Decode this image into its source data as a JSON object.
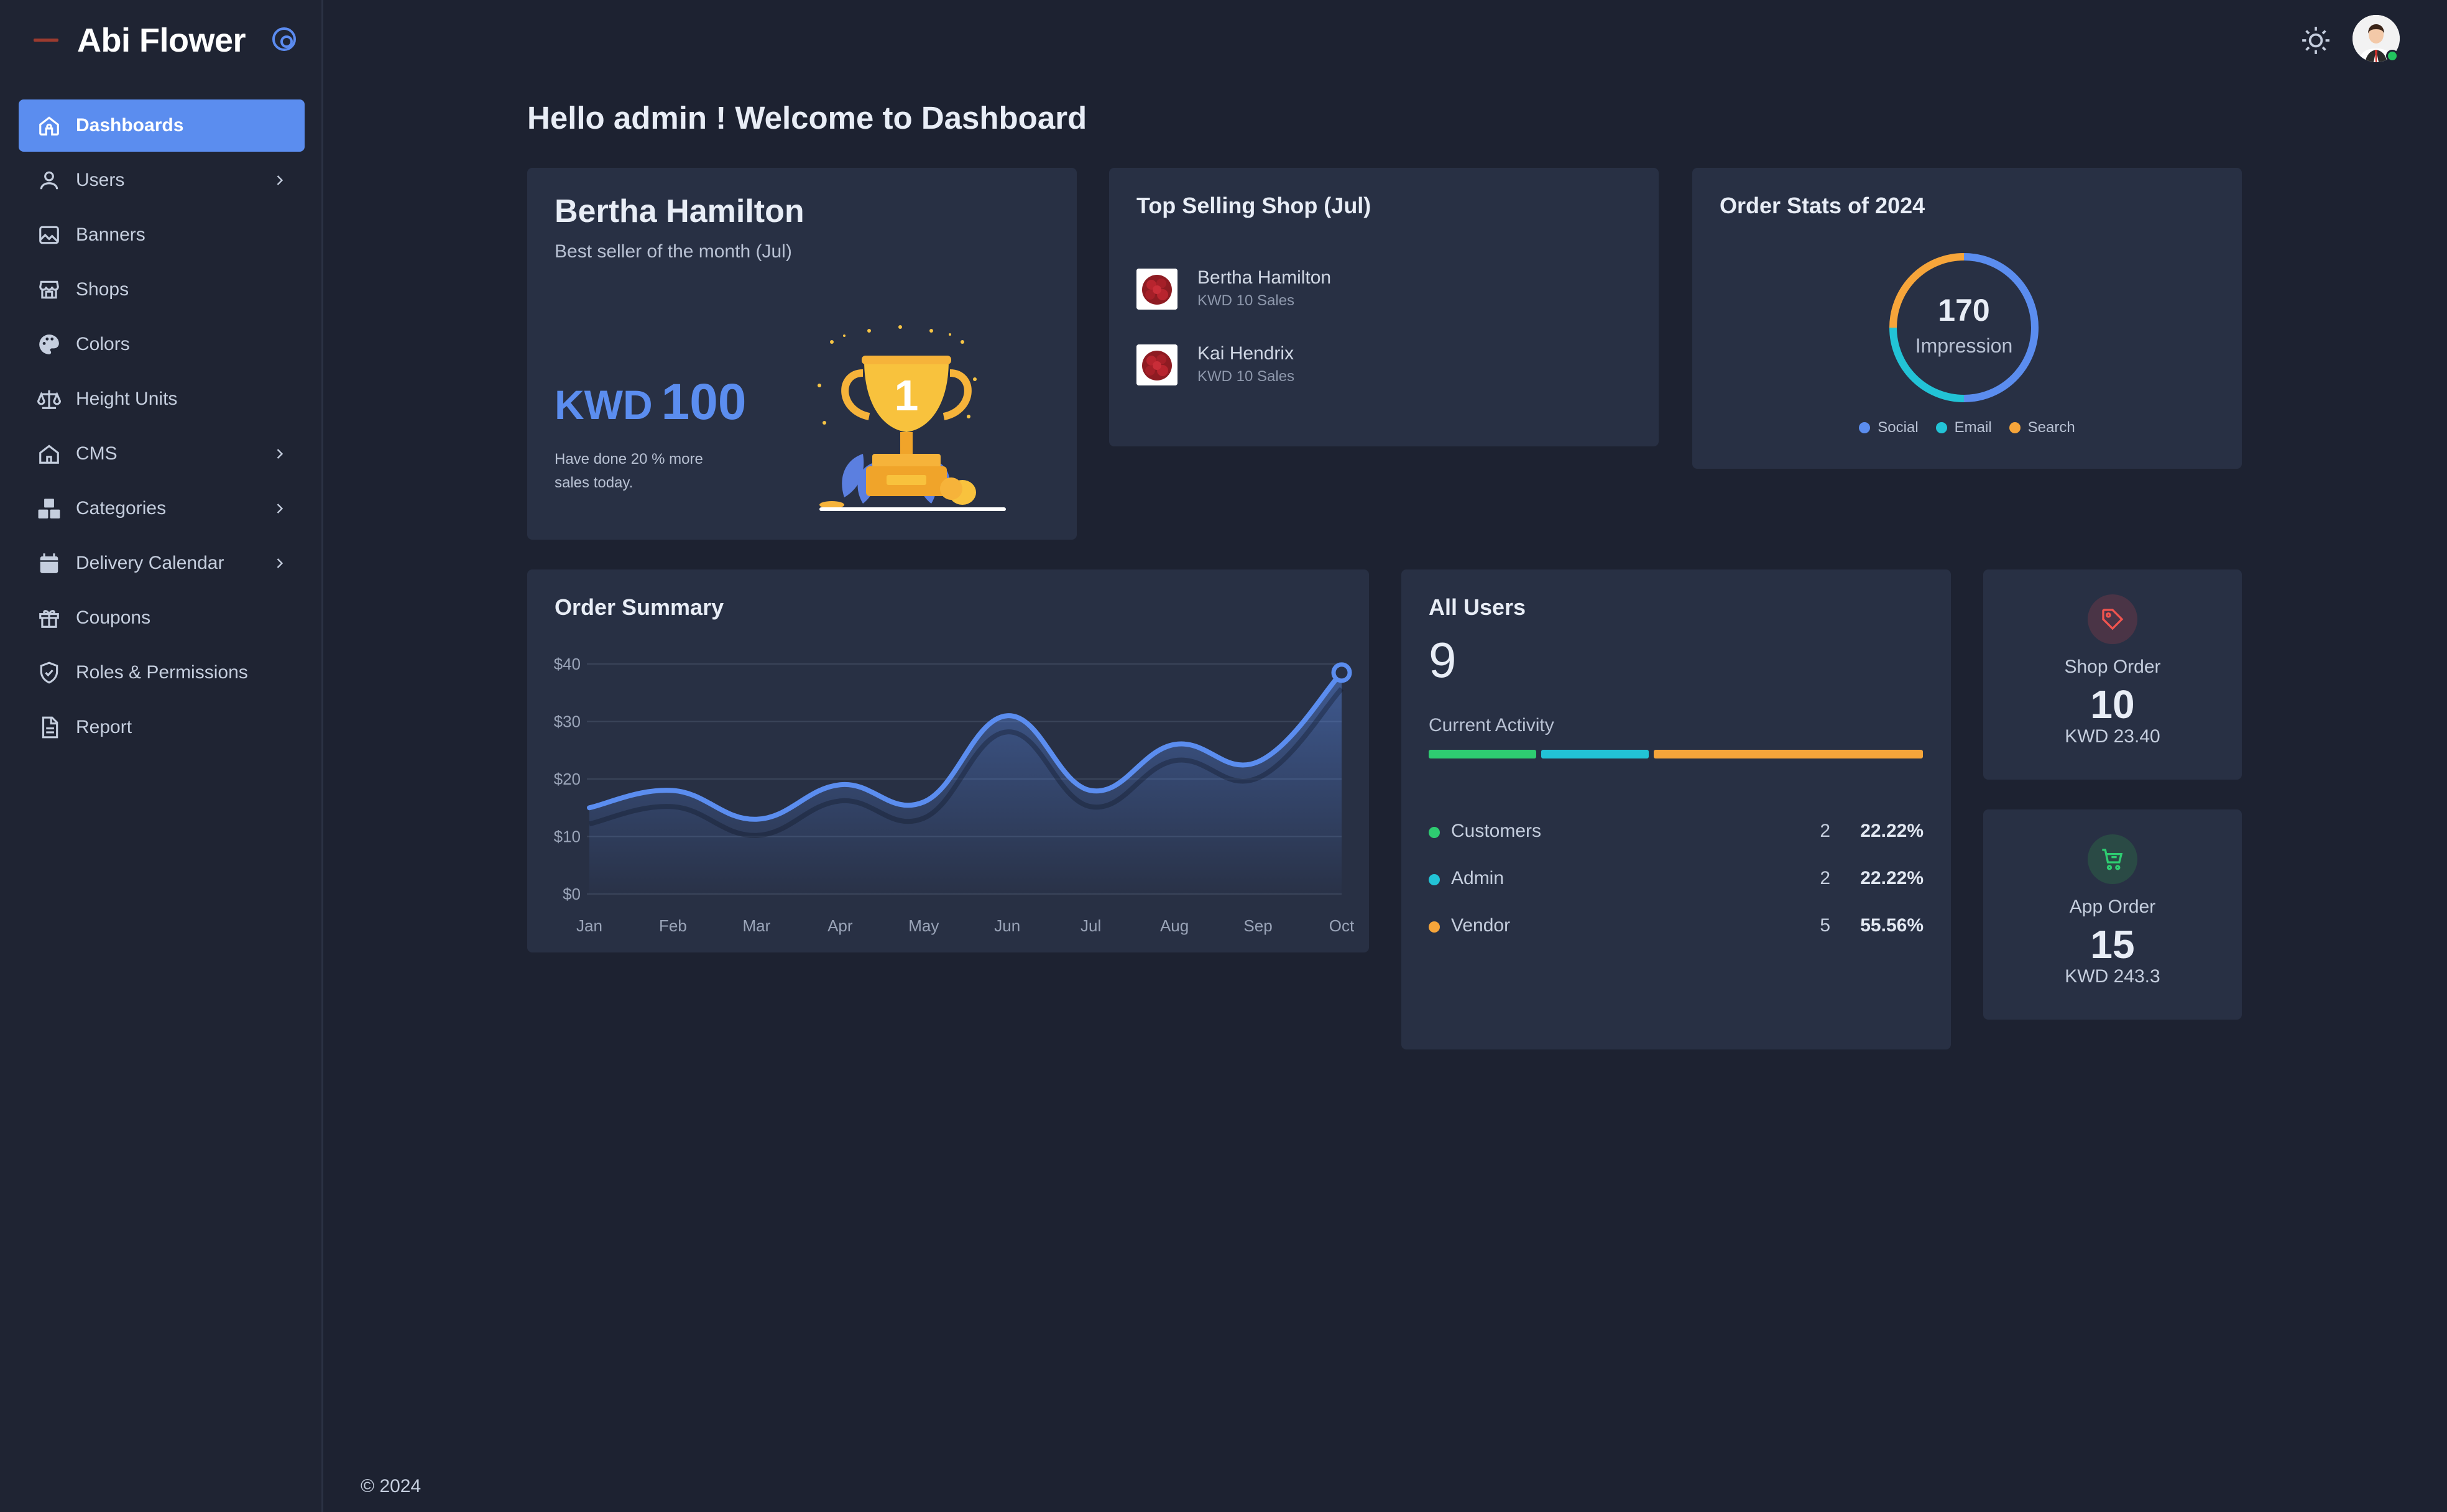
{
  "brand": {
    "name": "Abi Flower"
  },
  "sidebar": {
    "items": [
      {
        "label": "Dashboards",
        "icon": "home-icon",
        "active": true,
        "chevron": false
      },
      {
        "label": "Users",
        "icon": "user-icon",
        "active": false,
        "chevron": true
      },
      {
        "label": "Banners",
        "icon": "image-icon",
        "active": false,
        "chevron": false
      },
      {
        "label": "Shops",
        "icon": "store-icon",
        "active": false,
        "chevron": false
      },
      {
        "label": "Colors",
        "icon": "palette-icon",
        "active": false,
        "chevron": false
      },
      {
        "label": "Height Units",
        "icon": "scale-icon",
        "active": false,
        "chevron": false
      },
      {
        "label": "CMS",
        "icon": "home-outline-icon",
        "active": false,
        "chevron": true
      },
      {
        "label": "Categories",
        "icon": "boxes-icon",
        "active": false,
        "chevron": true
      },
      {
        "label": "Delivery Calendar",
        "icon": "calendar-icon",
        "active": false,
        "chevron": true
      },
      {
        "label": "Coupons",
        "icon": "gift-icon",
        "active": false,
        "chevron": false
      },
      {
        "label": "Roles & Permissions",
        "icon": "shield-check-icon",
        "active": false,
        "chevron": false
      },
      {
        "label": "Report",
        "icon": "file-icon",
        "active": false,
        "chevron": false
      }
    ]
  },
  "header": {
    "greeting": "Hello admin ! Welcome to Dashboard"
  },
  "winner": {
    "name": "Bertha Hamilton",
    "subtitle": "Best seller of the month (Jul)",
    "currency": "KWD",
    "amount": "100",
    "note": "Have done 20 % more sales today."
  },
  "top_selling": {
    "title": "Top Selling Shop (Jul)",
    "shops": [
      {
        "name": "Bertha Hamilton",
        "sales": "KWD 10 Sales"
      },
      {
        "name": "Kai Hendrix",
        "sales": "KWD 10 Sales"
      }
    ]
  },
  "order_stats": {
    "title": "Order Stats of 2024",
    "value": "170",
    "label": "Impression",
    "legend": [
      {
        "name": "Social",
        "color": "#5b8def"
      },
      {
        "name": "Email",
        "color": "#22c3d6"
      },
      {
        "name": "Search",
        "color": "#f6a53a"
      }
    ]
  },
  "order_summary": {
    "title": "Order Summary"
  },
  "chart_data": {
    "type": "area",
    "title": "Order Summary",
    "categories": [
      "Jan",
      "Feb",
      "Mar",
      "Apr",
      "May",
      "Jun",
      "Jul",
      "Aug",
      "Sep",
      "Oct"
    ],
    "series": [
      {
        "values": [
          15,
          18,
          13,
          19,
          16,
          31,
          18,
          26,
          23,
          38.5
        ]
      }
    ],
    "y_ticks": [
      "$0",
      "$10",
      "$20",
      "$30",
      "$40"
    ],
    "ylim": [
      0,
      40
    ],
    "grid": true,
    "color": "#5b8def"
  },
  "all_users": {
    "title": "All Users",
    "total": "9",
    "activity_label": "Current Activity",
    "rows": [
      {
        "label": "Customers",
        "count": "2",
        "percent": "22.22%",
        "color": "#2ecc71",
        "fraction": 0.2222
      },
      {
        "label": "Admin",
        "count": "2",
        "percent": "22.22%",
        "color": "#22c3d6",
        "fraction": 0.2222
      },
      {
        "label": "Vendor",
        "count": "5",
        "percent": "55.56%",
        "color": "#f6a53a",
        "fraction": 0.5556
      }
    ]
  },
  "shop_order": {
    "label": "Shop Order",
    "count": "10",
    "amount": "KWD 23.40",
    "color": "#f0544f"
  },
  "app_order": {
    "label": "App Order",
    "count": "15",
    "amount": "KWD 243.3",
    "color": "#2ecc71"
  },
  "footer": {
    "text": "© 2024"
  }
}
